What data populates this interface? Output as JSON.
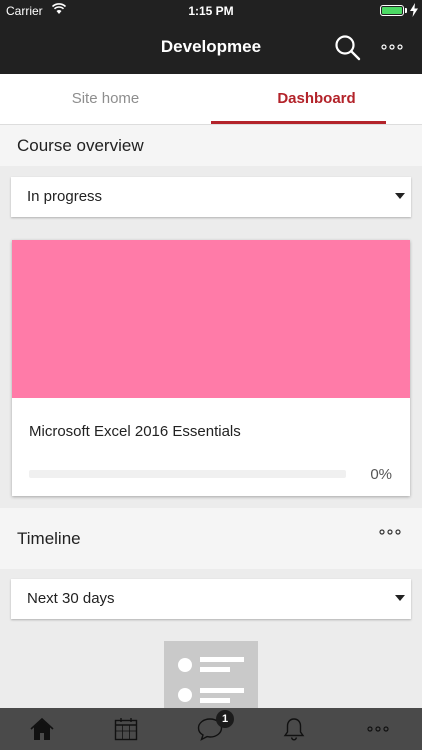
{
  "status_bar": {
    "carrier": "Carrier",
    "time": "1:15 PM"
  },
  "header": {
    "title": "Developmee"
  },
  "tabs": [
    {
      "label": "Site home",
      "active": false
    },
    {
      "label": "Dashboard",
      "active": true
    }
  ],
  "course_overview": {
    "title": "Course overview",
    "filter": "In progress",
    "courses": [
      {
        "name": "Microsoft Excel 2016 Essentials",
        "progress": 0,
        "progress_label": "0%",
        "image_color": "#ff7ba8"
      }
    ]
  },
  "timeline": {
    "title": "Timeline",
    "filter": "Next 30 days"
  },
  "bottom_nav": {
    "items": [
      "home-icon",
      "calendar-icon",
      "messages-icon",
      "notifications-icon",
      "more-icon"
    ],
    "messages_badge": "1"
  },
  "colors": {
    "accent": "#b3232a",
    "header_bg": "#212121",
    "nav_bg": "#4a4a4a"
  }
}
